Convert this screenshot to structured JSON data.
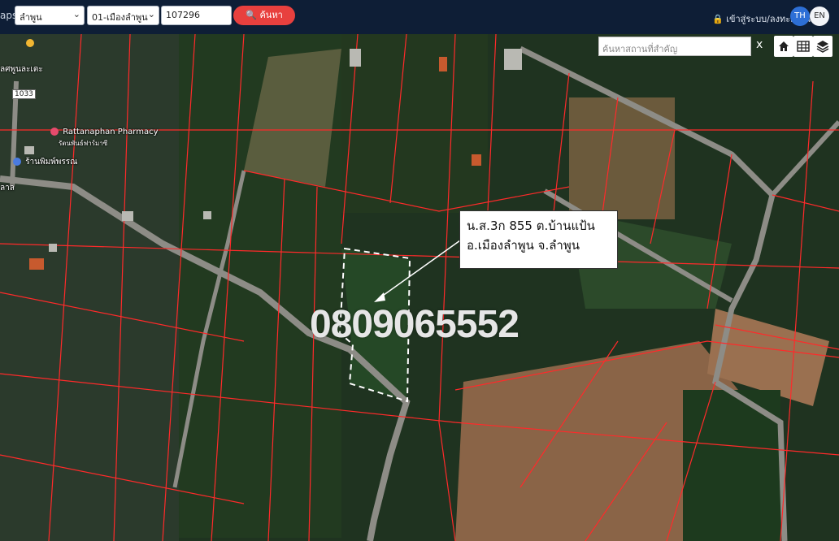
{
  "topbar": {
    "brand": "aps",
    "province_select": "ลำพูน",
    "district_select": "01-เมืองลำพูน",
    "parcel_input": "107296",
    "search_button": "ค้นหา",
    "login_link": "เข้าสู่ระบบ/ลงทะเบียน",
    "lang_th": "TH",
    "lang_en": "EN"
  },
  "map_tools": {
    "place_search_placeholder": "ค้นหาสถานที่สำคัญ",
    "clear_symbol": "x",
    "home_icon": "home-icon",
    "grid_icon": "grid-icon",
    "layers_icon": "layers-icon"
  },
  "callout": {
    "line1": "น.ส.3ก 855 ต.บ้านแป้น",
    "line2": "อ.เมืองลำพูน จ.ลำพูน"
  },
  "phone_overlay": "0809065552",
  "pois": {
    "pharmacy_name": "Rattanaphan Pharmacy",
    "pharmacy_thai": "รัตนพันธ์ฟาร์มาซี",
    "print_shop": "ร้านพิมพ์พรรณ",
    "route_number": "1033",
    "partial_label_top": "ลศพูนละเตะ",
    "partial_label_left": "ลาล"
  },
  "colors": {
    "topbar": "#0e1e36",
    "search_button": "#e8403e",
    "lang_active": "#2d6fd6",
    "parcel_lines": "#ff2a2a",
    "highlight_boundary": "#ffffff"
  }
}
